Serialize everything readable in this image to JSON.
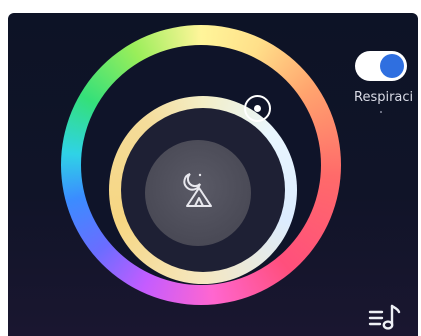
{
  "app": {
    "background_top": "#0d1326",
    "background_bottom": "#1a1630"
  },
  "color_wheel": {
    "outer_ring_colors": [
      "#fff59a",
      "#ffa46e",
      "#ff6a6a",
      "#ff66d0",
      "#c45cff",
      "#3b8cff",
      "#2fd3e6",
      "#34e07a",
      "#9aee5a"
    ],
    "inner_ring_colors": [
      "#f3eec6",
      "#e9f6ff",
      "#f7d682"
    ],
    "center_icon": "moon-tent-icon",
    "handle_icon": "ring-handle"
  },
  "breathing_toggle": {
    "label": "Respiraci",
    "on": true,
    "knob_color": "#2f6fe0"
  },
  "bottom_bar": {
    "playlist_icon": "music-playlist-icon"
  }
}
